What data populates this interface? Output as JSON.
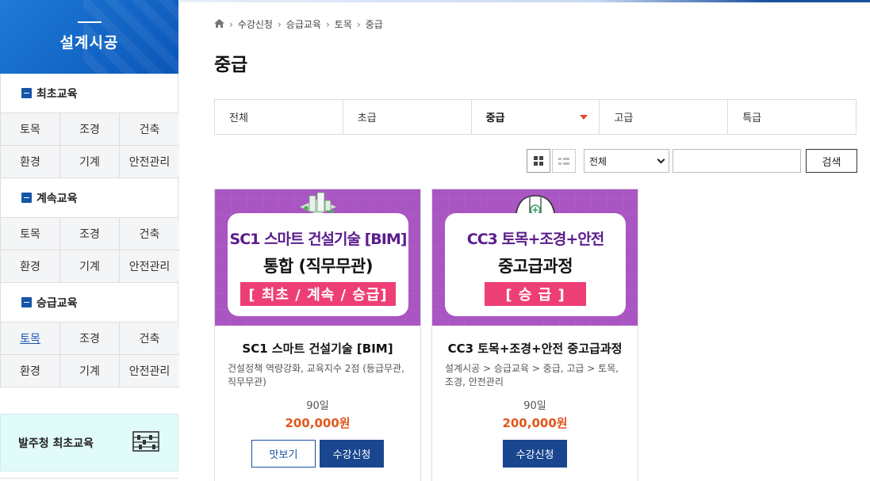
{
  "sidebar": {
    "header_title": "설계시공",
    "sections": [
      {
        "title": "최초교육",
        "items": [
          "토목",
          "조경",
          "건축",
          "환경",
          "기계",
          "안전관리"
        ]
      },
      {
        "title": "계속교육",
        "items": [
          "토목",
          "조경",
          "건축",
          "환경",
          "기계",
          "안전관리"
        ]
      },
      {
        "title": "승급교육",
        "items": [
          "토목",
          "조경",
          "건축",
          "환경",
          "기계",
          "안전관리"
        ]
      }
    ],
    "promo_label": "발주청 최초교육"
  },
  "breadcrumb": [
    "수강신청",
    "승급교육",
    "토목",
    "중급"
  ],
  "page_title": "중급",
  "tabs": [
    "전체",
    "초급",
    "중급",
    "고급",
    "특급"
  ],
  "toolbar": {
    "select_value": "전체",
    "search_button": "검색"
  },
  "courses": [
    {
      "thumb_line1": "SC1 스마트 건설기술 [BIM]",
      "thumb_line2": "통합 (직무무관)",
      "thumb_line3": "[ 최초 / 계속 / 승급]",
      "name": "SC1 스마트 건설기술 [BIM]",
      "desc": "건설정책 역량강화, 교육지수 2점 (등급무관, 직무무관)",
      "days": "90일",
      "price": "200,000원",
      "preview_button": "맛보기",
      "enroll_button": "수강신청"
    },
    {
      "thumb_line1": "CC3 토목+조경+안전",
      "thumb_line2": "중고급과정",
      "thumb_line3": "[ 승 급 ]",
      "name": "CC3 토목+조경+안전 중고급과정",
      "desc": "설계시공 > 승급교육 > 중급, 고급 > 토목, 조경, 안전관리",
      "days": "90일",
      "price": "200,000원",
      "enroll_button": "수강신청"
    }
  ],
  "colors": {
    "brand_blue": "#1a4690",
    "accent_orange": "#e2561d",
    "thumb_purple": "#a955c2",
    "thumb_pink": "#ee3e76"
  }
}
